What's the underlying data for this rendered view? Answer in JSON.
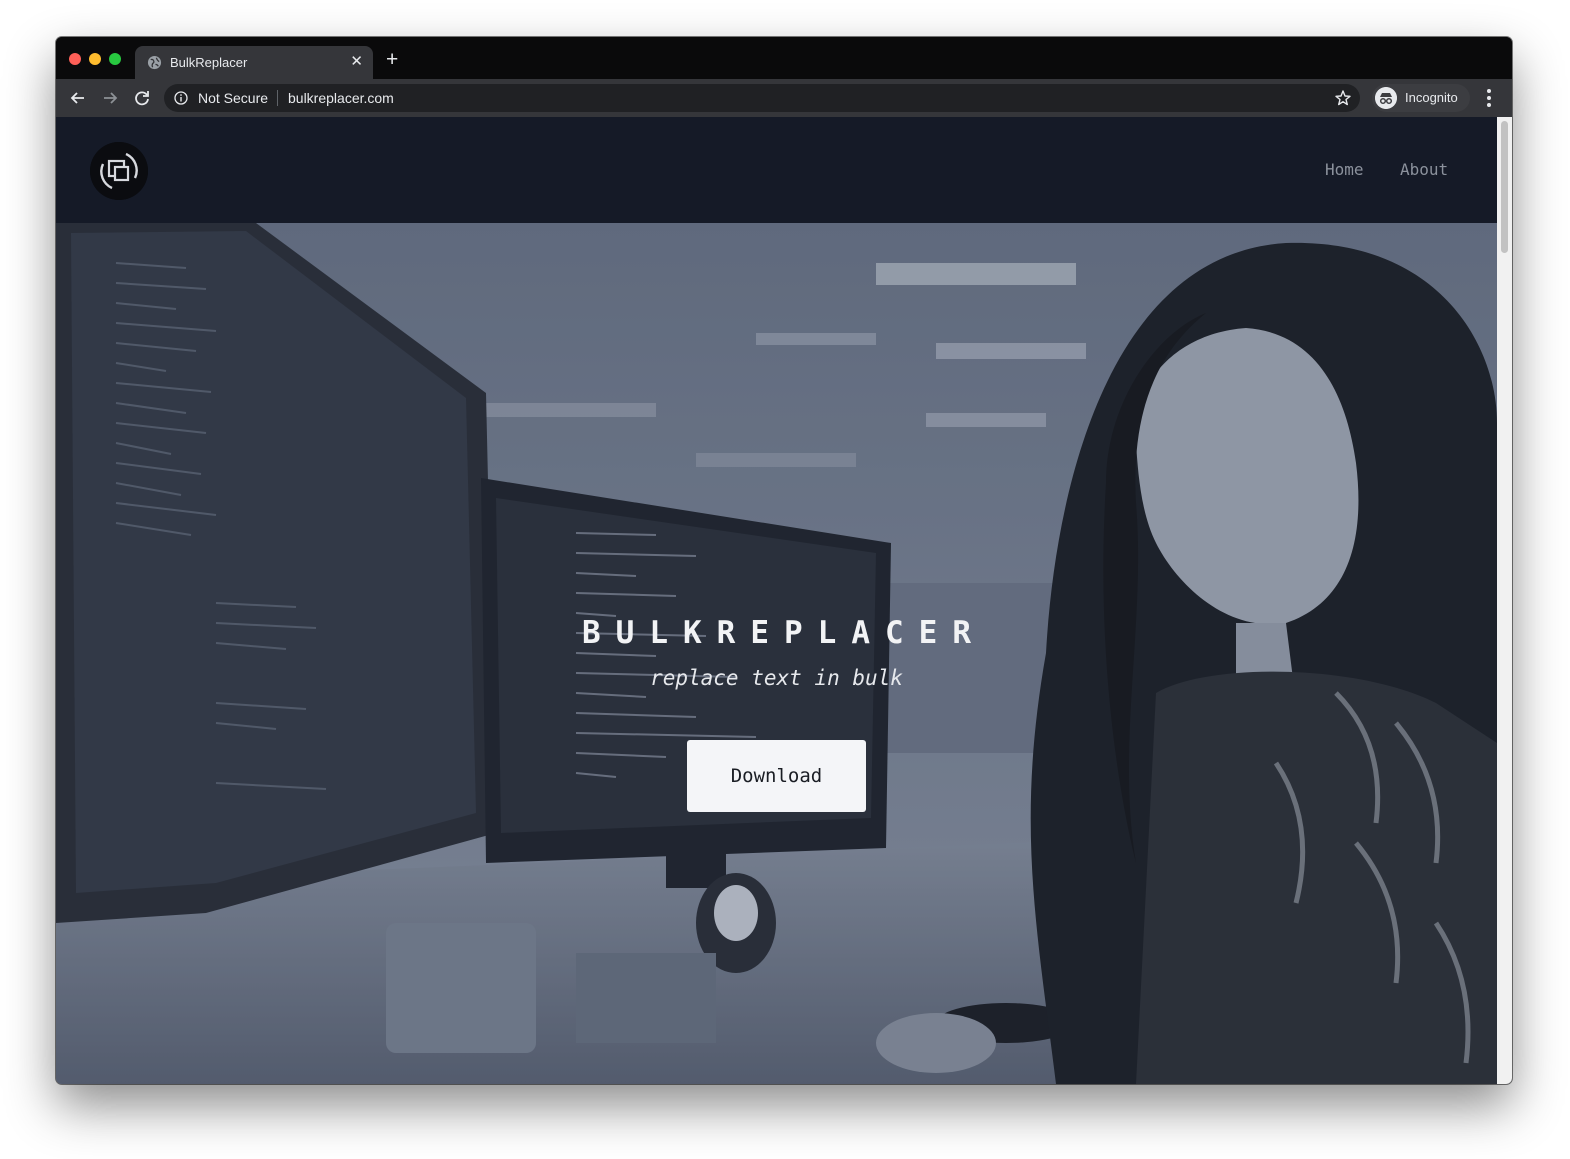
{
  "browser": {
    "tab_title": "BulkReplacer",
    "security_label": "Not Secure",
    "url": "bulkreplacer.com",
    "profile_label": "Incognito",
    "icons": [
      "close-icon",
      "new-tab-icon",
      "back-icon",
      "forward-icon",
      "reload-icon",
      "info-icon",
      "star-icon",
      "incognito-icon",
      "menu-icon"
    ]
  },
  "site": {
    "nav": {
      "links": [
        "Home",
        "About"
      ]
    },
    "hero": {
      "title": "BULKREPLACER",
      "subtitle": "replace text in bulk",
      "button_label": "Download"
    }
  },
  "colors": {
    "navbar": "#151a27",
    "hero_tint": "#5b6579",
    "button_bg": "#f4f5f8",
    "nav_link": "#8b919c"
  }
}
